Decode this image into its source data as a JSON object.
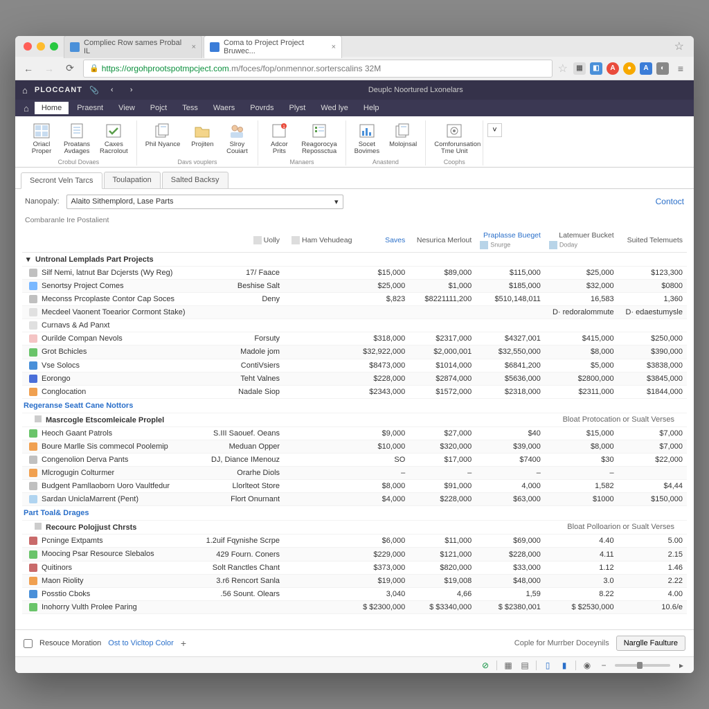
{
  "browser": {
    "tabs": [
      {
        "title": "Compliec Row sames Probal IL",
        "active": false
      },
      {
        "title": "Coma to Project Project Bruwec...",
        "active": true
      }
    ],
    "url_host": "https://orgohprootspotmpcject.com",
    "url_path": ".m/foces/fop/onmennor.sorterscalins 32M"
  },
  "app": {
    "brand": "PLOCCANT",
    "title": "Deuplc Noortured Lxonelars",
    "menu": [
      "Home",
      "Praesnt",
      "View",
      "Pojct",
      "Tess",
      "Waers",
      "Povrds",
      "Plyst",
      "Wed lye",
      "Help"
    ],
    "ribbon_groups": [
      {
        "label": "Crobul Dovaes",
        "buttons": [
          {
            "l1": "Oriacl",
            "l2": "Proper",
            "ic": "grid"
          },
          {
            "l1": "Proatans",
            "l2": "Avdages",
            "ic": "doc"
          },
          {
            "l1": "Caxes",
            "l2": "Racrolout",
            "ic": "check"
          }
        ]
      },
      {
        "label": "Davs vouplers",
        "buttons": [
          {
            "l1": "Phil Nyance",
            "l2": "",
            "ic": "pages"
          },
          {
            "l1": "Projiten",
            "l2": "",
            "ic": "folder"
          },
          {
            "l1": "Slroy",
            "l2": "Couiart",
            "ic": "people"
          }
        ]
      },
      {
        "label": "Manaers",
        "buttons": [
          {
            "l1": "Adcor",
            "l2": "Prits",
            "ic": "badge"
          },
          {
            "l1": "Reagorocya",
            "l2": "Repossctua",
            "ic": "task"
          }
        ]
      },
      {
        "label": "Anastend",
        "buttons": [
          {
            "l1": "Socet",
            "l2": "Bovimes",
            "ic": "chart"
          },
          {
            "l1": "Molojnsal",
            "l2": "",
            "ic": "pages"
          }
        ]
      },
      {
        "label": "Coophs",
        "buttons": [
          {
            "l1": "Comforunsation",
            "l2": "Tme Unit",
            "ic": "cfg"
          }
        ]
      }
    ],
    "tabs": [
      "Secront Veln Tarcs",
      "Toulapation",
      "Salted Backsy"
    ],
    "active_tab": 0,
    "filter_label": "Nanopaly:",
    "filter_value": "Alaito Sithemplord, Lase Parts",
    "contact": "Contoct",
    "subtitle": "Combaranle Ire Postalient"
  },
  "columns": [
    {
      "label": "",
      "align": "left"
    },
    {
      "label": "Uolly",
      "align": "right",
      "icon": "filter"
    },
    {
      "label": "Ham Vehudeag",
      "align": "right",
      "icon": "col"
    },
    {
      "label": "Saves",
      "align": "right",
      "blue": true
    },
    {
      "label": "Nesurica Merlout",
      "align": "right"
    },
    {
      "label": "Praplasse Bueget",
      "align": "right",
      "blue": true,
      "sub": "Snurge"
    },
    {
      "label": "Latemuer Bucket",
      "align": "right",
      "sub": "Doday"
    },
    {
      "label": "Suited Telemuets",
      "align": "right"
    }
  ],
  "groups": [
    {
      "title": "Untronal Lemplads Part Projects",
      "expanded": true,
      "rows": [
        {
          "ic": "#c0c0c0",
          "name": "Silf Nemi, latnut Bar Dcjersts (Wy Reg)",
          "c2": "17/ Faace",
          "c3": "",
          "c4": "$15,000",
          "c5": "$89,000",
          "c6": "$115,000",
          "c7": "$25,000",
          "c8": "$123,300"
        },
        {
          "ic": "#7ab8ff",
          "name": "Senortsy Project Comes",
          "c2": "Beshise Salt",
          "c3": "",
          "c4": "$25,000",
          "c5": "$1,000",
          "c6": "$185,000",
          "c7": "$32,000",
          "c8": "$0800"
        },
        {
          "ic": "#c0c0c0",
          "name": "Meconss Prcoplaste Contor Cap Soces",
          "c2": "Deny",
          "c3": "",
          "c4": "$,823",
          "c5": "$8221111,200",
          "c6": "$510,148,011",
          "c7": "16,583",
          "c8": "1,360"
        },
        {
          "ic": "#e0e0e0",
          "name": "Mecdeel Vaonent Toearior Cormont Stake)",
          "c2": "",
          "c3": "",
          "c4": "",
          "c5": "",
          "c6": "",
          "c7": "D· redoralommute",
          "c8": "D· edaestumysle"
        },
        {
          "ic": "#e0e0e0",
          "name": "Curnavs & Ad Panxt",
          "c2": "",
          "c3": "",
          "c4": "",
          "c5": "",
          "c6": "",
          "c7": "",
          "c8": ""
        }
      ]
    },
    {
      "title": "",
      "rows": [
        {
          "ic": "#f4c4c4",
          "name": "Ourilde Compan Nevols",
          "c2": "Forsuty",
          "c3": "",
          "c4": "$318,000",
          "c5": "$2317,000",
          "c6": "$4327,001",
          "c7": "$415,000",
          "c8": "$250,000"
        },
        {
          "ic": "#6ac46a",
          "name": "Grot Bchicles",
          "c2": "Madole jom",
          "c3": "",
          "c4": "$32,922,000",
          "c5": "$2,000,001",
          "c6": "$32,550,000",
          "c7": "$8,000",
          "c8": "$390,000"
        },
        {
          "ic": "#4a90d9",
          "name": "Vse Solocs",
          "c2": "ContiVsiers",
          "c3": "",
          "c4": "$8473,000",
          "c5": "$1014,000",
          "c6": "$6841,200",
          "c7": "$5,000",
          "c8": "$3838,000"
        },
        {
          "ic": "#4a6fd9",
          "name": "Eorongo",
          "c2": "Teht Valnes",
          "c3": "",
          "c4": "$228,000",
          "c5": "$2874,000",
          "c6": "$5636,000",
          "c7": "$2800,000",
          "c8": "$3845,000"
        },
        {
          "ic": "#f0a050",
          "name": "Conglocation",
          "c2": "Nadale Siop",
          "c3": "",
          "c4": "$2343,000",
          "c5": "$1572,000",
          "c6": "$2318,000",
          "c7": "$2311,000",
          "c8": "$1844,000"
        }
      ]
    }
  ],
  "sections": [
    {
      "header": "Regeranse Seatt Cane Nottors",
      "sub": "Masrcogle Etscomleicale Proplel",
      "right": "Bloat Protocation or Sualt Verses",
      "rows": [
        {
          "ic": "#6ac46a",
          "name": "Heoch Gaant Patrols",
          "c2": "S.III Saouef. Oeans",
          "c4": "$9,000",
          "c5": "$27,000",
          "c6": "$40",
          "c7": "$15,000",
          "c8": "$7,000"
        },
        {
          "ic": "#f0a050",
          "name": "Boure Marlle Sis commecol Poolemip",
          "c2": "Meduan Opper",
          "c4": "$10,000",
          "c5": "$320,000",
          "c6": "$39,000",
          "c7": "$8,000",
          "c8": "$7,000"
        },
        {
          "ic": "#c0c0c0",
          "name": "Congenolion Derva Pants",
          "c2": "DJ, Diance IMenouz",
          "c4": "SO",
          "c5": "$17,000",
          "c6": "$7400",
          "c7": "$30",
          "c8": "$22,000"
        },
        {
          "ic": "#f0a050",
          "name": "Mlcrogugin Colturmer",
          "c2": "Orarhe Diols",
          "c4": "–",
          "c5": "–",
          "c6": "–",
          "c7": "–",
          "c8": ""
        },
        {
          "ic": "#c0c0c0",
          "name": "Budgent Pamllaoborn Uoro Vaultfedur",
          "c2": "Llorlteot Store",
          "c4": "$8,000",
          "c5": "$91,000",
          "c6": "4,000",
          "c7": "1,582",
          "c8": "$4,44"
        },
        {
          "ic": "#b0d4f0",
          "name": "Sardan UniclaMarrent (Pent)",
          "c2": "Flort Onurnant",
          "c4": "$4,000",
          "c5": "$228,000",
          "c6": "$63,000",
          "c7": "$1000",
          "c8": "$150,000"
        }
      ]
    },
    {
      "header": "Part Toal& Drages",
      "sub": "Recourc Polojjust Chrsts",
      "right": "Bloat Polloarion or Sualt Verses",
      "rows": [
        {
          "ic": "#c96a6a",
          "name": "Pcninge Extpamts",
          "c2": "1.2uif Fqynishe Scrpe",
          "c4": "$6,000",
          "c5": "$11,000",
          "c6": "$69,000",
          "c7": "4.40",
          "c8": "5.00"
        },
        {
          "ic": "#6ac46a",
          "name": "Moocing Psar Resource Slebalos",
          "c2": "429 Fourn. Coners",
          "c4": "$229,000",
          "c5": "$121,000",
          "c6": "$228,000",
          "c7": "4.11",
          "c8": "2.15"
        },
        {
          "ic": "#c96a6a",
          "name": "Quitinors",
          "c2": "Solt Ranctles Chant",
          "c4": "$373,000",
          "c5": "$820,000",
          "c6": "$33,000",
          "c7": "1.12",
          "c8": "1.46"
        },
        {
          "ic": "#f0a050",
          "name": "Maon Riolity",
          "c2": "3.r6 Rencort Sanla",
          "c4": "$19,000",
          "c5": "$19,008",
          "c6": "$48,000",
          "c7": "3.0",
          "c8": "2.22"
        },
        {
          "ic": "#4a90d9",
          "name": "Posstio Cboks",
          "c2": ".56 Sount. Olears",
          "c4": "3,040",
          "c5": "4,66",
          "c6": "1,59",
          "c7": "8.22",
          "c8": "4.00"
        },
        {
          "ic": "#6ac46a",
          "name": "Inohorry Vulth Prolee Paring",
          "c2": "",
          "c4": "$   $2300,000",
          "c5": "$   $3340,000",
          "c6": "$   $2380,001",
          "c7": "$   $2530,000",
          "c8": "10.6/e"
        }
      ]
    }
  ],
  "footer": {
    "checkbox_label": "Resouce Moration",
    "link": "Ost to Vicltop Color",
    "plus": "+",
    "copy_label": "Cople for Murrber Doceynils",
    "button": "Narglle Faulture"
  }
}
